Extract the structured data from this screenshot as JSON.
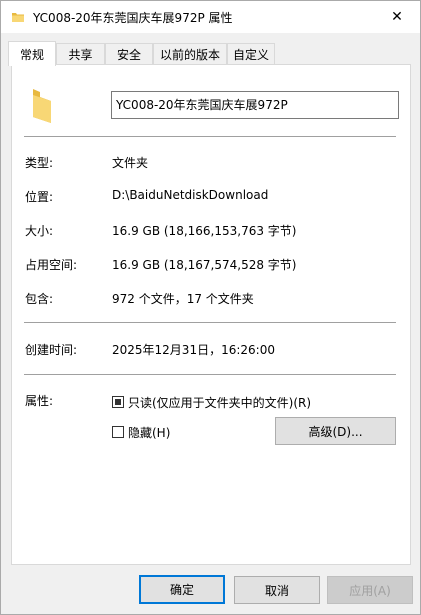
{
  "window": {
    "title": "YC008-20年东莞国庆车展972P 属性",
    "close_glyph": "✕"
  },
  "tabs": [
    {
      "label": "常规",
      "active": true
    },
    {
      "label": "共享"
    },
    {
      "label": "安全"
    },
    {
      "label": "以前的版本"
    },
    {
      "label": "自定义"
    }
  ],
  "general": {
    "icon": "folder-icon",
    "folder_name": "YC008-20年东莞国庆车展972P",
    "rows": [
      {
        "label": "类型:",
        "value": "文件夹"
      },
      {
        "label": "位置:",
        "value": "D:\\BaiduNetdiskDownload"
      },
      {
        "label": "大小:",
        "value": "16.9 GB (18,166,153,763 字节)"
      },
      {
        "label": "占用空间:",
        "value": "16.9 GB (18,167,574,528 字节)"
      },
      {
        "label": "包含:",
        "value": "972 个文件，17 个文件夹"
      }
    ],
    "created_label": "创建时间:",
    "created_value": "2025年12月31日，16:26:00",
    "attributes_label": "属性:",
    "readonly_label": "只读(仅应用于文件夹中的文件)(R)",
    "readonly_state": "indeterminate",
    "hidden_label": "隐藏(H)",
    "hidden_checked": false,
    "advanced_button": "高级(D)..."
  },
  "footer": {
    "ok": "确定",
    "cancel": "取消",
    "apply": "应用(A)"
  },
  "colors": {
    "accent": "#0078d7",
    "folder": "#f8d775",
    "folder_dark": "#e8b93f"
  }
}
